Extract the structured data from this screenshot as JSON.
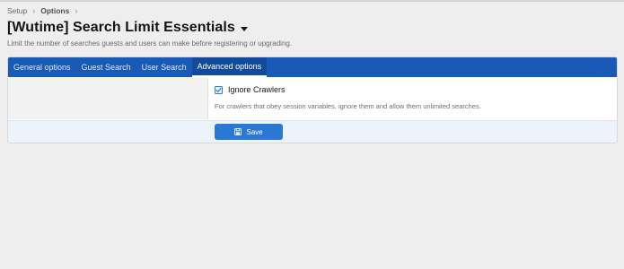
{
  "breadcrumb": {
    "items": [
      "Setup",
      "Options"
    ],
    "separator": "›"
  },
  "header": {
    "title": "[Wutime] Search Limit Essentials",
    "description": "Limit the number of searches guests and users can make before registering or upgrading."
  },
  "tabs": [
    {
      "label": "General options",
      "active": false
    },
    {
      "label": "Guest Search",
      "active": false
    },
    {
      "label": "User Search",
      "active": false
    },
    {
      "label": "Advanced options",
      "active": true
    }
  ],
  "options": {
    "ignore_crawlers": {
      "label": "Ignore Crawlers",
      "checked": true,
      "hint": "For crawlers that obey session variables, ignore them and allow them unlimited searches."
    }
  },
  "form": {
    "save_label": "Save"
  },
  "colors": {
    "tab_bar": "#185ab5",
    "accent": "#2a77d4",
    "page_background": "#eeeeee"
  }
}
